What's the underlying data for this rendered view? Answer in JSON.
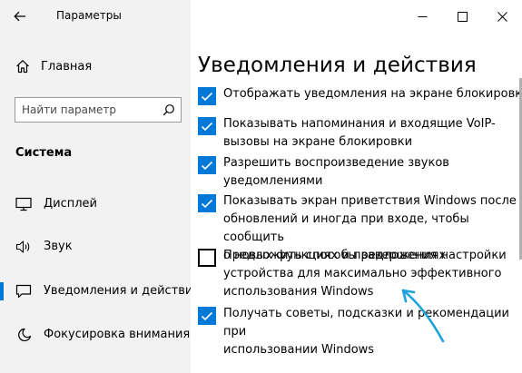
{
  "window": {
    "title": "Параметры",
    "accent_color": "#0078d7"
  },
  "sidebar": {
    "home_label": "Главная",
    "search_placeholder": "Найти параметр",
    "section_title": "Система",
    "items": [
      {
        "label": "Дисплей",
        "icon": "monitor-icon"
      },
      {
        "label": "Звук",
        "icon": "speaker-icon"
      },
      {
        "label": "Уведомления и действия",
        "icon": "notification-icon",
        "active": true
      },
      {
        "label": "Фокусировка внимания",
        "icon": "moon-icon"
      }
    ]
  },
  "main": {
    "title": "Уведомления и действия",
    "options": [
      {
        "label": "Отображать уведомления на экране блокировки",
        "checked": true
      },
      {
        "label": "Показывать напоминания и входящие VoIP-\nвызовы на экране блокировки",
        "checked": true
      },
      {
        "label": "Разрешить  воспроизведение звуков\nуведомлениями",
        "checked": true
      },
      {
        "label": "Показывать экран приветствия Windows после\nобновлений и иногда при входе, чтобы сообщить\nо новых функциях и предложениях",
        "checked": true
      },
      {
        "label": "Предложить способы завершения настройки\nустройства для максимально эффективного\nиспользования Windows",
        "checked": false
      },
      {
        "label": "Получать советы, подсказки и рекомендации при\nиспользовании Windows",
        "checked": true
      }
    ]
  }
}
